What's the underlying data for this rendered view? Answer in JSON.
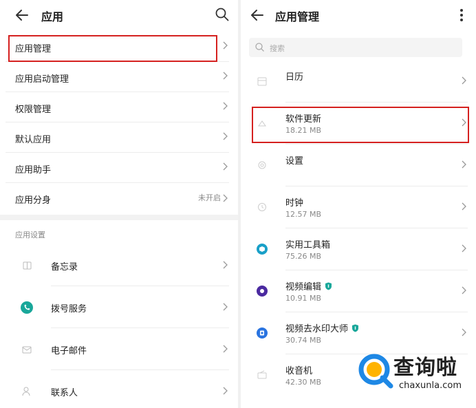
{
  "left": {
    "title": "应用",
    "menu": [
      {
        "label": "应用管理",
        "value": ""
      },
      {
        "label": "应用启动管理",
        "value": ""
      },
      {
        "label": "权限管理",
        "value": ""
      },
      {
        "label": "默认应用",
        "value": ""
      },
      {
        "label": "应用助手",
        "value": ""
      },
      {
        "label": "应用分身",
        "value": "未开启"
      }
    ],
    "section_label": "应用设置",
    "apps": [
      {
        "label": "备忘录",
        "icon": "note-icon"
      },
      {
        "label": "拨号服务",
        "icon": "phone-icon"
      },
      {
        "label": "电子邮件",
        "icon": "email-icon"
      },
      {
        "label": "联系人",
        "icon": "contact-icon"
      }
    ]
  },
  "right": {
    "title": "应用管理",
    "search_placeholder": "搜索",
    "apps": [
      {
        "name": "日历",
        "size": "",
        "icon": "calendar-icon",
        "shield": false
      },
      {
        "name": "软件更新",
        "size": "18.21 MB",
        "icon": "update-icon",
        "shield": false
      },
      {
        "name": "设置",
        "size": "",
        "icon": "settings-icon",
        "shield": false
      },
      {
        "name": "时钟",
        "size": "12.57 MB",
        "icon": "clock-icon",
        "shield": false
      },
      {
        "name": "实用工具箱",
        "size": "75.26 MB",
        "icon": "toolbox-icon",
        "shield": false
      },
      {
        "name": "视频编辑",
        "size": "10.91 MB",
        "icon": "video-edit-icon",
        "shield": true
      },
      {
        "name": "视频去水印大师",
        "size": "30.74 MB",
        "icon": "watermark-remover-icon",
        "shield": true
      },
      {
        "name": "收音机",
        "size": "42.30 MB",
        "icon": "radio-icon",
        "shield": false
      }
    ]
  },
  "watermark": {
    "brand": "查询啦",
    "url": "chaxunla.com"
  },
  "colors": {
    "highlight": "#d5201f",
    "teal": "#19a79a",
    "purple": "#4b2aa0",
    "blue": "#2a74e0"
  }
}
